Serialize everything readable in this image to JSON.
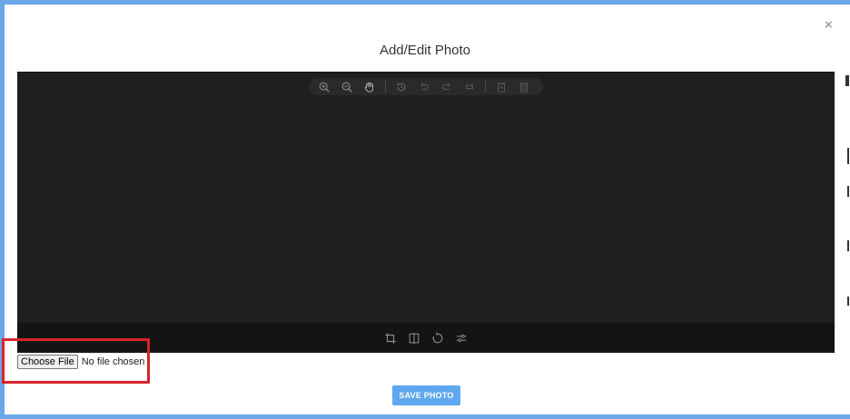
{
  "modal": {
    "title": "Add/Edit Photo",
    "close_label": "×"
  },
  "editor": {
    "top_tools": [
      {
        "icon": "zoom-in-icon"
      },
      {
        "icon": "zoom-out-icon"
      },
      {
        "icon": "hand-icon"
      },
      {
        "icon": "history-icon"
      },
      {
        "icon": "undo-icon"
      },
      {
        "icon": "redo-icon"
      },
      {
        "icon": "reset-icon"
      },
      {
        "icon": "delete-icon"
      },
      {
        "icon": "delete-all-icon"
      }
    ],
    "bottom_tools": [
      {
        "icon": "crop-icon"
      },
      {
        "icon": "flip-icon"
      },
      {
        "icon": "rotate-icon"
      },
      {
        "icon": "filter-icon"
      }
    ]
  },
  "file_input": {
    "button_label": "Choose File",
    "status": "No file chosen"
  },
  "actions": {
    "save_label": "SAVE PHOTO"
  },
  "colors": {
    "frame": "#6aa6e8",
    "editor_bg": "#1f1f1f",
    "save_button": "#5fa7ee",
    "highlight": "#d9222a"
  }
}
